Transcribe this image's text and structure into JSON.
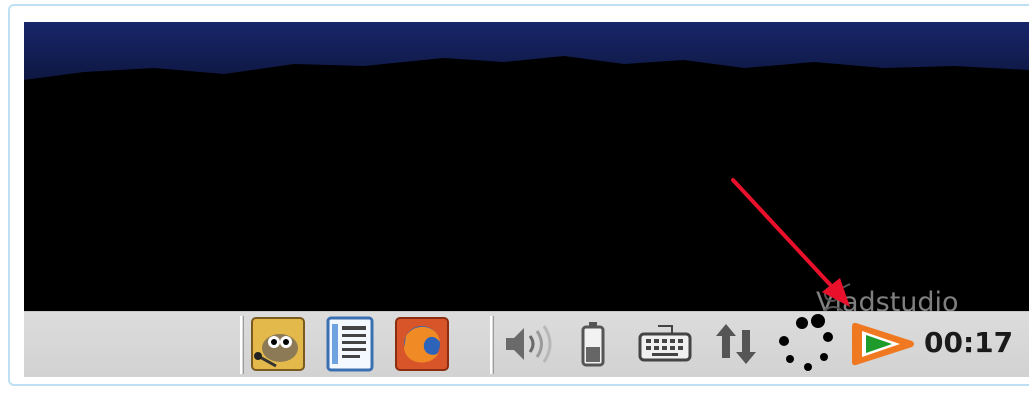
{
  "desktop": {
    "wallpaper_colors": {
      "sky": "#0f1a4a",
      "ground": "#000000"
    },
    "watermark": {
      "text": "Vladstudio",
      "icon": "vladstudio-logo-icon"
    }
  },
  "taskbar": {
    "launchers": [
      {
        "name": "gimp-launcher",
        "icon": "gimp-icon"
      },
      {
        "name": "text-editor-launcher",
        "icon": "document-icon"
      },
      {
        "name": "firefox-launcher",
        "icon": "firefox-icon"
      }
    ],
    "tray": [
      {
        "name": "volume",
        "icon": "speaker-icon"
      },
      {
        "name": "battery",
        "icon": "battery-icon"
      },
      {
        "name": "keyboard-layout",
        "icon": "keyboard-icon"
      },
      {
        "name": "network",
        "icon": "network-updown-icon"
      },
      {
        "name": "loading",
        "icon": "spinner-icon"
      },
      {
        "name": "media-player",
        "icon": "play-orange-icon"
      }
    ],
    "clock": "00:17"
  },
  "annotation": {
    "color": "#e8102a",
    "points_to": "media-player"
  }
}
